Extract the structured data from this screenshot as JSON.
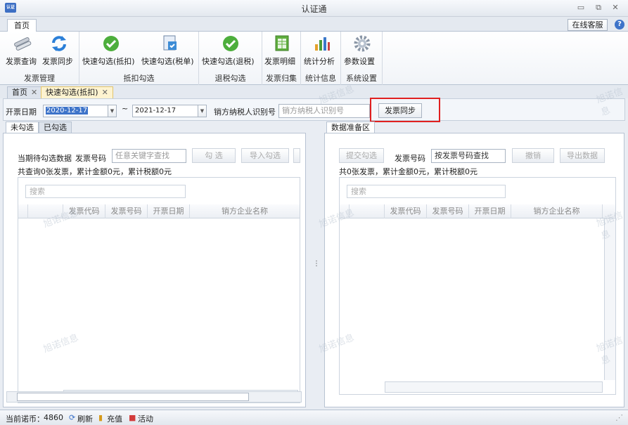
{
  "window": {
    "title": "认证通",
    "app_icon_text": "认证"
  },
  "ribbon_tabs": {
    "home": "首页",
    "online_service": "在线客服",
    "help": "?"
  },
  "ribbon": {
    "groups": [
      {
        "label": "发票管理",
        "buttons": [
          "发票查询",
          "发票同步"
        ]
      },
      {
        "label": "抵扣勾选",
        "buttons": [
          "快速勾选(抵扣)",
          "快速勾选(税单)"
        ]
      },
      {
        "label": "退税勾选",
        "buttons": [
          "快速勾选(退税)"
        ]
      },
      {
        "label": "发票归集",
        "buttons": [
          "发票明细"
        ]
      },
      {
        "label": "统计信息",
        "buttons": [
          "统计分析"
        ]
      },
      {
        "label": "系统设置",
        "buttons": [
          "参数设置"
        ]
      }
    ]
  },
  "doc_tabs": [
    "首页",
    "快速勾选(抵扣)"
  ],
  "filter": {
    "date_label": "开票日期",
    "date_from": "2020-12-17",
    "range_sep": "~",
    "date_to": "2021-12-17",
    "seller_label": "销方纳税人识别号",
    "seller_placeholder": "销方纳税人识别号",
    "sync_button": "发票同步"
  },
  "left_panel": {
    "tabs": [
      "未勾选",
      "已勾选"
    ],
    "pending_label": "当期待勾选数据",
    "invoice_no_label": "发票号码",
    "invoice_no_placeholder": "任意关键字查找",
    "check_button": "勾  选",
    "import_button": "导入勾选",
    "summary": "共查询0张发票，累计金额0元，累计税额0元",
    "search_placeholder": "搜索",
    "columns": [
      "发票代码",
      "发票号码",
      "开票日期",
      "销方企业名称"
    ]
  },
  "right_panel": {
    "tab": "数据准备区",
    "submit_button": "提交勾选",
    "invoice_no_label": "发票号码",
    "invoice_no_placeholder": "按发票号码查找",
    "cancel_button": "撤销",
    "export_button": "导出数据",
    "summary": "共0张发票，累计金额0元，累计税额0元",
    "search_placeholder": "搜索",
    "columns": [
      "发票代码",
      "发票号码",
      "开票日期",
      "销方企业名称"
    ]
  },
  "watermark": "旭诺信息",
  "status": {
    "coins_label": "当前诺币：",
    "coins_value": "4860",
    "refresh": "刷新",
    "recharge": "充值",
    "activity": "活动"
  }
}
